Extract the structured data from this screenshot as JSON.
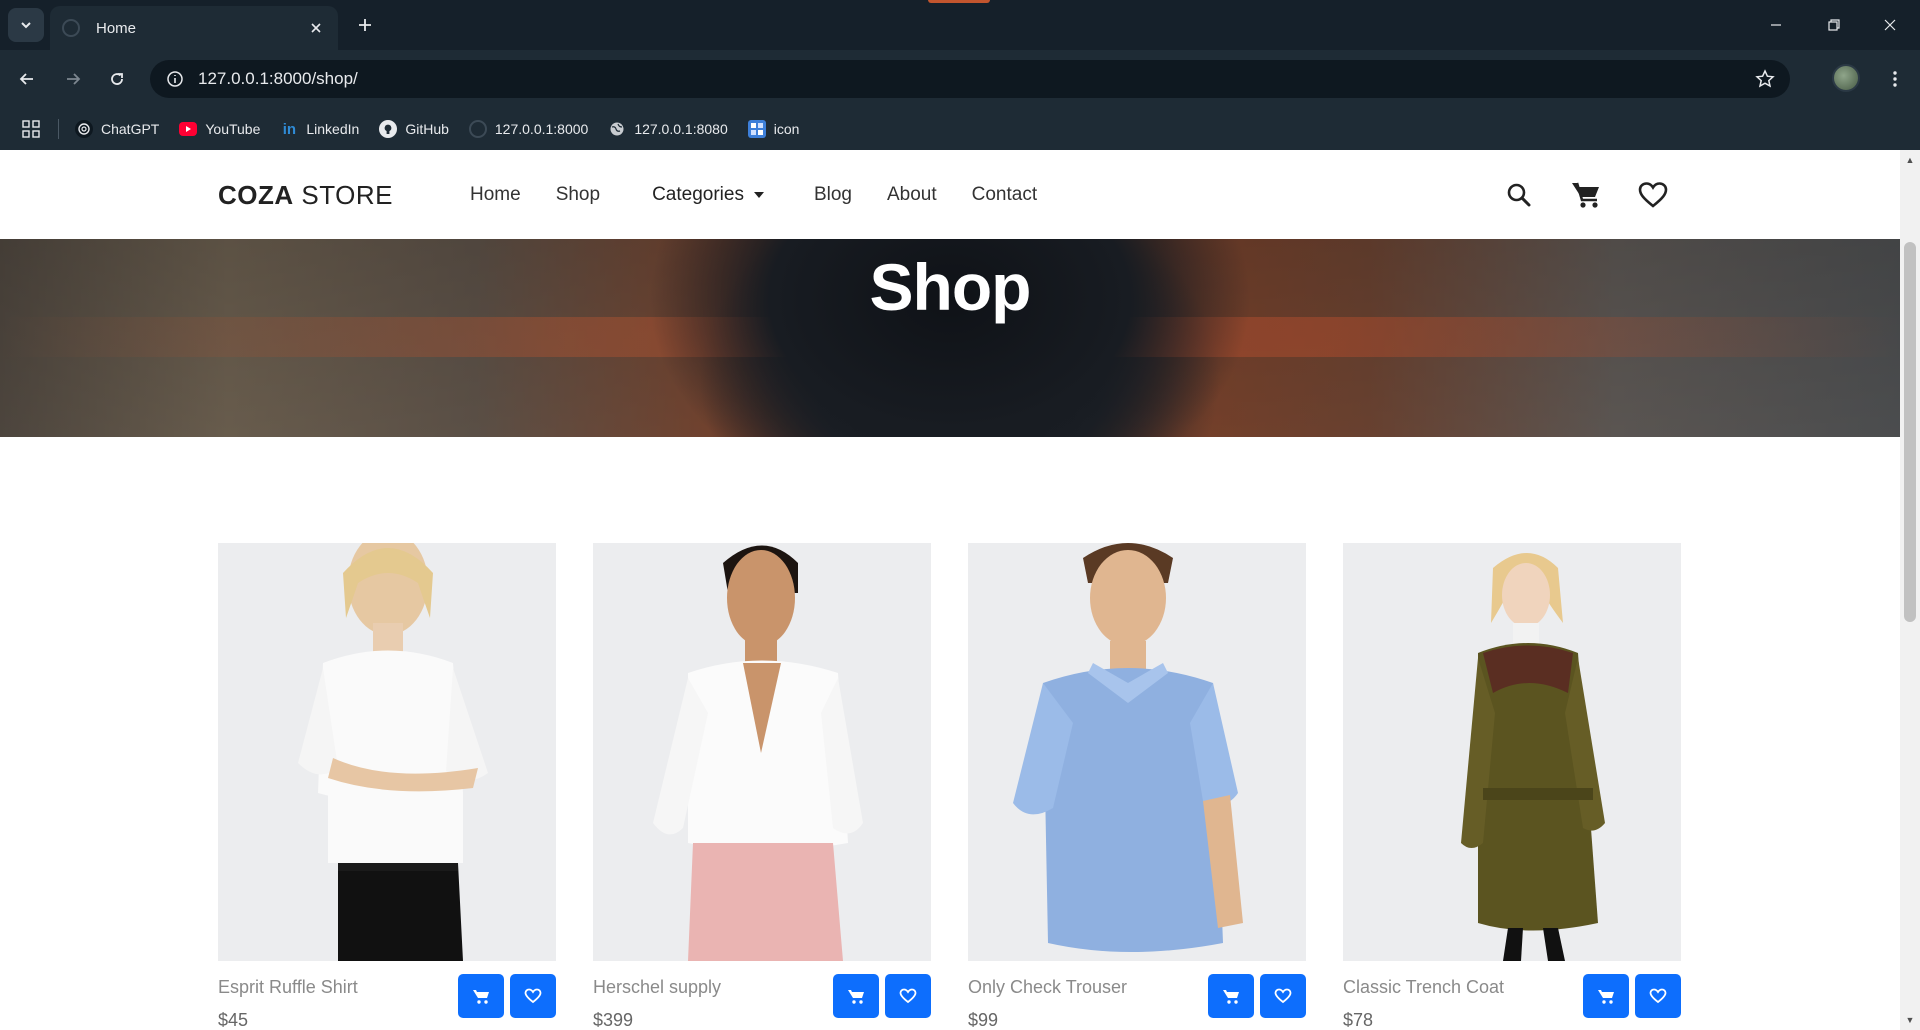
{
  "browser": {
    "tab": {
      "title": "Home"
    },
    "address_bar": {
      "url": "127.0.0.1:8000/shop/"
    },
    "bookmarks": [
      {
        "label": "ChatGPT",
        "icon": "chatgpt-icon"
      },
      {
        "label": "YouTube",
        "icon": "youtube-icon"
      },
      {
        "label": "LinkedIn",
        "icon": "linkedin-icon"
      },
      {
        "label": "GitHub",
        "icon": "github-icon"
      },
      {
        "label": "127.0.0.1:8000",
        "icon": "page-icon"
      },
      {
        "label": "127.0.0.1:8080",
        "icon": "globe-icon"
      },
      {
        "label": "icon",
        "icon": "bookmark-icon"
      }
    ]
  },
  "site": {
    "logo": {
      "bold": "COZA",
      "light": " STORE"
    },
    "nav": {
      "home": "Home",
      "shop": "Shop",
      "categories": "Categories",
      "blog": "Blog",
      "about": "About",
      "contact": "Contact"
    },
    "hero": {
      "title": "Shop"
    },
    "products": [
      {
        "name": "Esprit Ruffle Shirt",
        "price": "$45"
      },
      {
        "name": "Herschel supply",
        "price": "$399"
      },
      {
        "name": "Only Check Trouser",
        "price": "$99"
      },
      {
        "name": "Classic Trench Coat",
        "price": "$78"
      }
    ]
  },
  "colors": {
    "accent_button": "#0d6efd",
    "chrome_bg": "#1e2b35"
  }
}
